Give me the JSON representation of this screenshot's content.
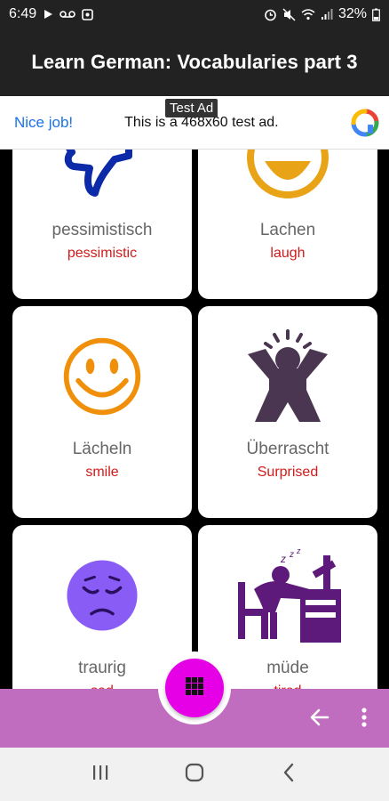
{
  "status_bar": {
    "time": "6:49",
    "battery": "32%",
    "icons": [
      "play-icon",
      "voicemail-icon",
      "square-app-icon",
      "alarm-icon",
      "mute-icon",
      "wifi-icon",
      "signal-icon",
      "battery-icon"
    ]
  },
  "app_bar": {
    "title": "Learn German: Vocabularies part 3"
  },
  "ad": {
    "badge": "Test Ad",
    "cta": "Nice job!",
    "text": "This is a 468x60 test ad.",
    "logo_icon": "ad-logo-icon"
  },
  "cards": [
    {
      "german": "pessimistisch",
      "english": "pessimistic",
      "icon": "thumbs-down-icon",
      "color": "#0d2aa8"
    },
    {
      "german": "Lachen",
      "english": "laugh",
      "icon": "laughing-face-icon",
      "color": "#e8a317"
    },
    {
      "german": "Lächeln",
      "english": "smile",
      "icon": "smiling-face-icon",
      "color": "#f0900a"
    },
    {
      "german": "Überrascht",
      "english": "Surprised",
      "icon": "surprised-person-icon",
      "color": "#4a3650"
    },
    {
      "german": "traurig",
      "english": "sad",
      "icon": "sad-face-icon",
      "color": "#8a5cf6"
    },
    {
      "german": "müde",
      "english": "tired",
      "icon": "tired-person-icon",
      "color": "#5e1a7a"
    }
  ],
  "bottom_bar": {
    "fab_icon": "grid-icon",
    "back_icon": "arrow-left-icon",
    "more_icon": "more-vert-icon",
    "colors": {
      "bar": "#c06cbf",
      "fab": "#e600e6"
    }
  },
  "nav": {
    "icons": [
      "recents-icon",
      "home-icon",
      "back-icon"
    ]
  },
  "colors": {
    "german_text": "#666666",
    "english_text": "#d21a1a",
    "ad_cta": "#1a73e8"
  }
}
